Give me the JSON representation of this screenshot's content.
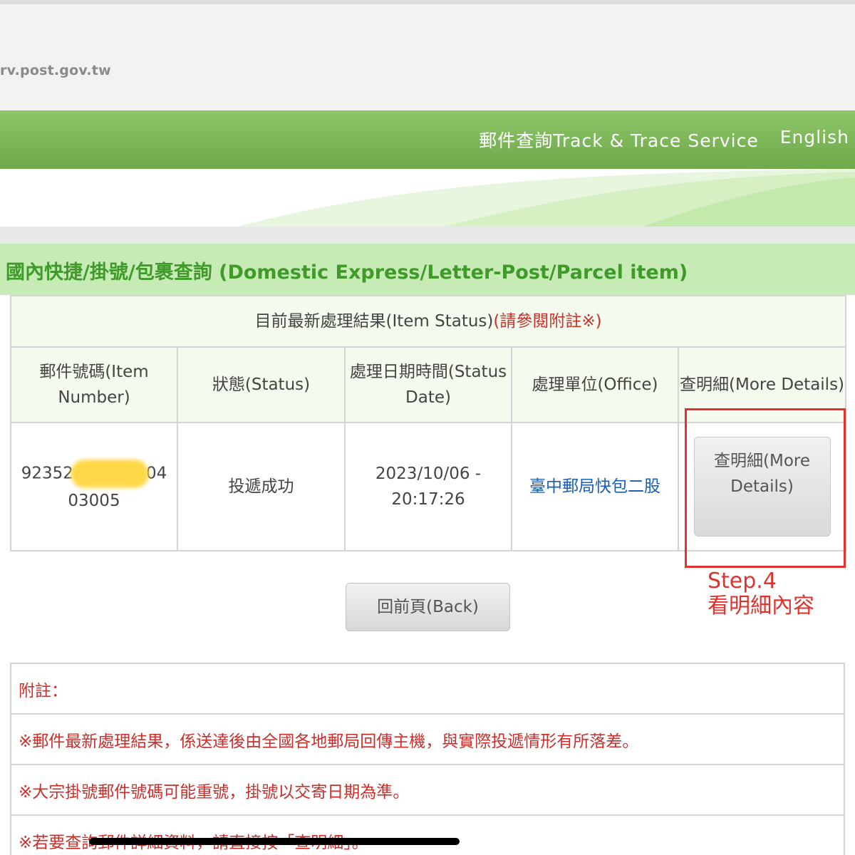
{
  "browser": {
    "url": "rv.post.gov.tw"
  },
  "nav": {
    "track_service": "郵件查詢Track & Trace Service",
    "english": "English"
  },
  "section": {
    "title": "國內快捷/掛號/包裹查詢 (Domestic Express/Letter-Post/Parcel item)"
  },
  "table": {
    "caption": "目前最新處理結果(Item Status)",
    "caption_note": "(請參閱附註※)",
    "headers": {
      "item_number": "郵件號碼(Item Number)",
      "status": "狀態(Status)",
      "status_date": "處理日期時間(Status Date)",
      "office": "處理單位(Office)",
      "more_details": "查明細(More Details)"
    },
    "row": {
      "item_number_prefix": "92352",
      "item_number_suffix": "04",
      "item_number_line2": "03005",
      "status": "投遞成功",
      "status_date": "2023/10/06 - 20:17:26",
      "office": "臺中郵局快包二股",
      "details_button": "查明細(More Details)"
    }
  },
  "annotation": {
    "step": "Step.4",
    "description": "看明細內容"
  },
  "back_button": "回前頁(Back)",
  "notes": {
    "title": "附註：",
    "items": [
      "※郵件最新處理結果，係送達後由全國各地郵局回傳主機，與實際投遞情形有所落差。",
      "※大宗掛號郵件號碼可能重號，掛號以交寄日期為準。",
      "※若要查詢郵件詳細資料，請直接按「查明細」。"
    ]
  },
  "colors": {
    "green_bar": "#7ab456",
    "title_bar": "#c6ebb4",
    "title_text": "#3f9a2a",
    "note_red": "#c9302c",
    "highlight_red": "#e0322f",
    "office_link": "#1a5fb4"
  }
}
